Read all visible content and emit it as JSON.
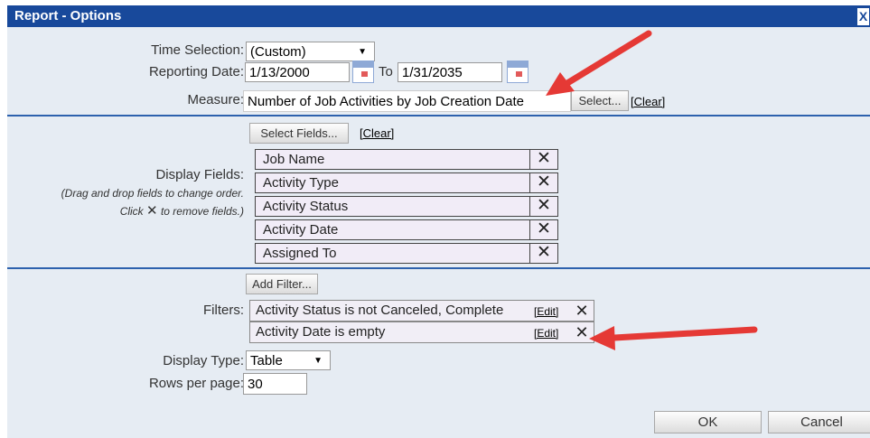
{
  "dialog": {
    "title": "Report - Options",
    "close_glyph": "X"
  },
  "time_selection": {
    "label": "Time Selection:",
    "value": "(Custom)"
  },
  "reporting_date": {
    "label": "Reporting Date:",
    "from": "1/13/2000",
    "to_label": "To",
    "to": "1/31/2035"
  },
  "measure": {
    "label": "Measure:",
    "value": "Number of Job Activities by Job Creation Date",
    "select_label": "Select...",
    "clear_label": "[Clear]"
  },
  "display_fields": {
    "select_label": "Select Fields...",
    "clear_label": "[Clear]",
    "label": "Display Fields:",
    "hint1": "(Drag and drop fields to change order.",
    "hint2_pre": "Click",
    "hint2_post": "to remove fields.)",
    "items": [
      "Job Name",
      "Activity Type",
      "Activity Status",
      "Activity Date",
      "Assigned To"
    ]
  },
  "filters": {
    "add_label": "Add Filter...",
    "label": "Filters:",
    "edit_label": "[Edit]",
    "items": [
      "Activity Status is not Canceled, Complete",
      "Activity Date is empty"
    ]
  },
  "display_type": {
    "label": "Display Type:",
    "value": "Table"
  },
  "rows_per_page": {
    "label": "Rows per page:",
    "value": "30"
  },
  "buttons": {
    "ok": "OK",
    "cancel": "Cancel"
  },
  "colors": {
    "title_bar": "#18499b",
    "panel": "#e6ecf3",
    "annotation_arrow": "#e53935"
  },
  "icons": {
    "remove": "close-icon",
    "calendar": "calendar-icon",
    "dropdown": "dropdown-arrow-icon"
  }
}
